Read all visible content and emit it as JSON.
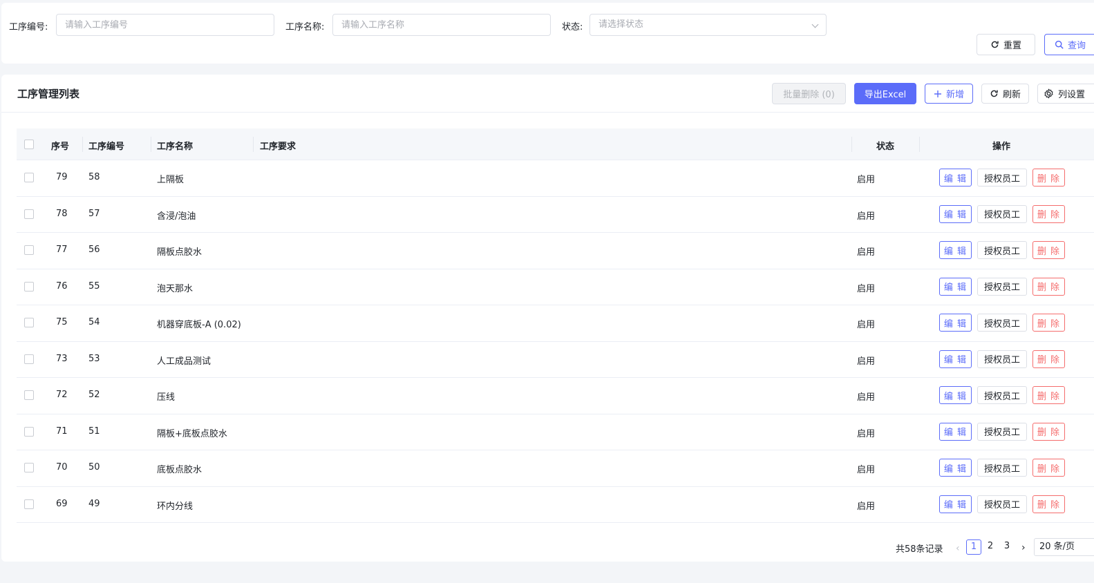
{
  "search": {
    "code_label": "工序编号:",
    "code_placeholder": "请输入工序编号",
    "name_label": "工序名称:",
    "name_placeholder": "请输入工序名称",
    "status_label": "状态:",
    "status_placeholder": "请选择状态",
    "reset_label": "重置",
    "query_label": "查询"
  },
  "list": {
    "title": "工序管理列表",
    "batch_delete_label": "批量删除 (0)",
    "export_label": "导出Excel",
    "add_label": "新增",
    "refresh_label": "刷新",
    "columns_label": "列设置"
  },
  "table": {
    "headers": {
      "index": "序号",
      "code": "工序编号",
      "name": "工序名称",
      "requirement": "工序要求",
      "status": "状态",
      "actions": "操作"
    },
    "action_labels": {
      "edit": "编 辑",
      "authorize": "授权员工",
      "delete": "删 除"
    },
    "rows": [
      {
        "index": "79",
        "code": "58",
        "name": "上隔板",
        "requirement": "",
        "status": "启用"
      },
      {
        "index": "78",
        "code": "57",
        "name": "含浸/泡油",
        "requirement": "",
        "status": "启用"
      },
      {
        "index": "77",
        "code": "56",
        "name": "隔板点胶水",
        "requirement": "",
        "status": "启用"
      },
      {
        "index": "76",
        "code": "55",
        "name": "泡天那水",
        "requirement": "",
        "status": "启用"
      },
      {
        "index": "75",
        "code": "54",
        "name": "机器穿底板-A (0.02)",
        "requirement": "",
        "status": "启用"
      },
      {
        "index": "73",
        "code": "53",
        "name": "人工成品测试",
        "requirement": "",
        "status": "启用"
      },
      {
        "index": "72",
        "code": "52",
        "name": "压线",
        "requirement": "",
        "status": "启用"
      },
      {
        "index": "71",
        "code": "51",
        "name": "隔板+底板点胶水",
        "requirement": "",
        "status": "启用"
      },
      {
        "index": "70",
        "code": "50",
        "name": "底板点胶水",
        "requirement": "",
        "status": "启用"
      },
      {
        "index": "69",
        "code": "49",
        "name": "环内分线",
        "requirement": "",
        "status": "启用"
      }
    ]
  },
  "pagination": {
    "total_text": "共58条记录",
    "pages": [
      "1",
      "2",
      "3"
    ],
    "current_page": "1",
    "page_size": "20 条/页"
  },
  "colors": {
    "primary": "#5b6cf9",
    "danger": "#f56c6c",
    "border": "#dcdfe6"
  }
}
